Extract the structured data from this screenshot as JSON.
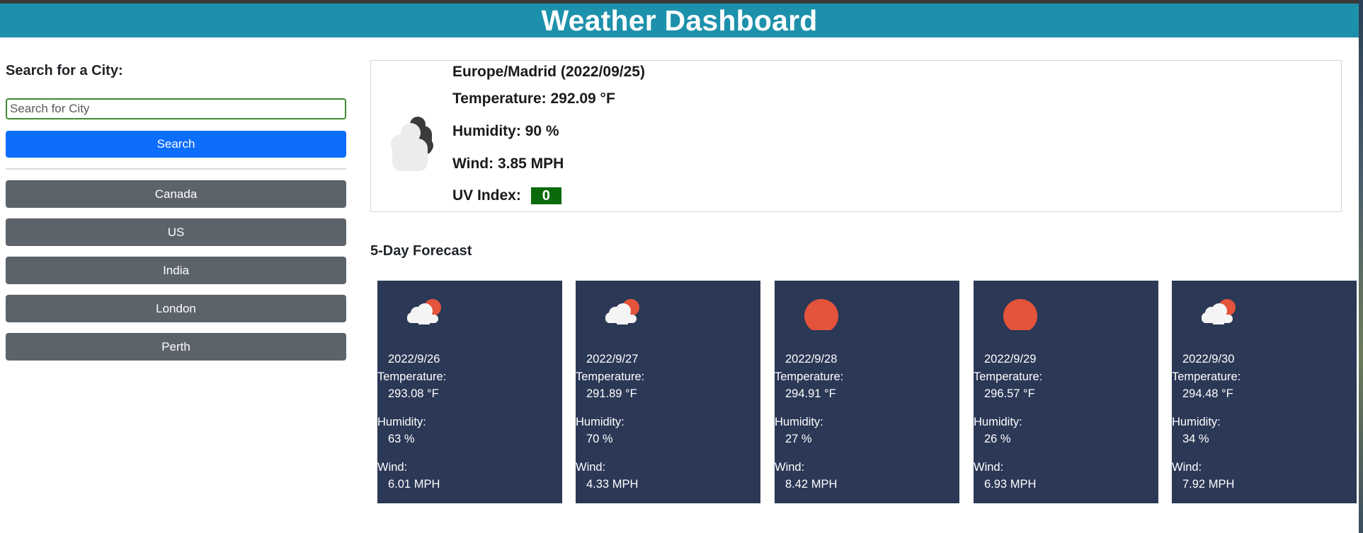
{
  "app": {
    "title": "Weather Dashboard"
  },
  "colors": {
    "header": "#1d91ab",
    "search_button": "#0d6efd",
    "city_button": "#5c636a",
    "forecast_card": "#2b3856",
    "uv_badge": "#0b6a0b",
    "sun": "#e4533b"
  },
  "sidebar": {
    "heading": "Search for a City:",
    "search_placeholder": "Search for City",
    "search_value": "",
    "search_button_label": "Search",
    "cities": [
      {
        "label": "Canada"
      },
      {
        "label": "US"
      },
      {
        "label": "India"
      },
      {
        "label": "London"
      },
      {
        "label": "Perth"
      }
    ]
  },
  "current": {
    "icon": "dark-clouds-icon",
    "title": "Europe/Madrid (2022/09/25)",
    "temperature": "Temperature: 292.09 °F",
    "humidity": "Humidity: 90 %",
    "wind": "Wind: 3.85 MPH",
    "uv_label": "UV Index:",
    "uv_value": "0"
  },
  "forecast": {
    "heading": "5-Day Forecast",
    "temperature_label": "Temperature:",
    "humidity_label": "Humidity:",
    "wind_label": "Wind:",
    "days": [
      {
        "date": "2022/9/26",
        "icon": "cloud-sun-icon",
        "temperature": "293.08 °F",
        "humidity": "63 %",
        "wind": "6.01 MPH"
      },
      {
        "date": "2022/9/27",
        "icon": "cloud-sun-icon",
        "temperature": "291.89 °F",
        "humidity": "70 %",
        "wind": "4.33 MPH"
      },
      {
        "date": "2022/9/28",
        "icon": "sun-icon",
        "temperature": "294.91 °F",
        "humidity": "27 %",
        "wind": "8.42 MPH"
      },
      {
        "date": "2022/9/29",
        "icon": "sun-icon",
        "temperature": "296.57 °F",
        "humidity": "26 %",
        "wind": "6.93 MPH"
      },
      {
        "date": "2022/9/30",
        "icon": "cloud-sun-icon",
        "temperature": "294.48 °F",
        "humidity": "34 %",
        "wind": "7.92 MPH"
      }
    ]
  }
}
